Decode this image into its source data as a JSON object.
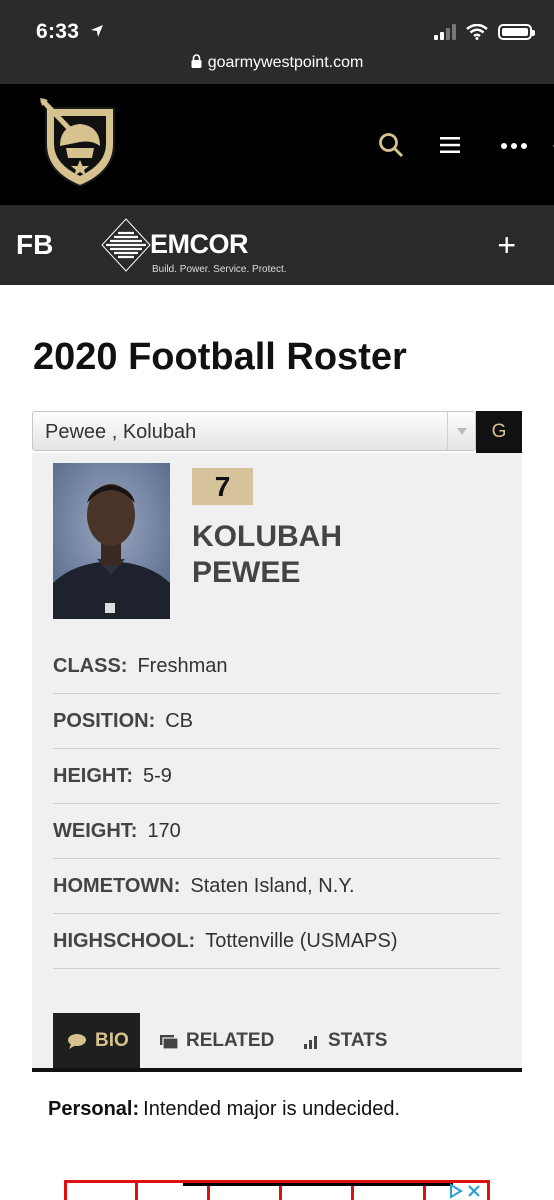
{
  "status_bar": {
    "time": "6:33",
    "url": "goarmywestpoint.com"
  },
  "header": {
    "icons": [
      "search-icon",
      "menu-icon",
      "more-icon",
      "ticket-icon"
    ]
  },
  "sponsor": {
    "sport": "FB",
    "brand": "EMCOR",
    "tagline": "Build. Power. Service. Protect."
  },
  "page": {
    "title": "2020 Football Roster"
  },
  "selector": {
    "selected": "Pewee , Kolubah",
    "go_label": "G"
  },
  "player": {
    "number": "7",
    "first_name": "KOLUBAH",
    "last_name": "PEWEE",
    "info": [
      {
        "label": "CLASS:",
        "value": "Freshman"
      },
      {
        "label": "POSITION:",
        "value": "CB"
      },
      {
        "label": "HEIGHT:",
        "value": "5-9"
      },
      {
        "label": "WEIGHT:",
        "value": "170"
      },
      {
        "label": "HOMETOWN:",
        "value": "Staten Island, N.Y."
      },
      {
        "label": "HIGHSCHOOL:",
        "value": "Tottenville (USMAPS)"
      }
    ]
  },
  "tabs": [
    {
      "label": "BIO",
      "active": true,
      "icon": "speech-bubble-icon"
    },
    {
      "label": "RELATED",
      "active": false,
      "icon": "stack-icon"
    },
    {
      "label": "STATS",
      "active": false,
      "icon": "bar-chart-icon"
    }
  ],
  "bio": {
    "personal_label": "Personal:",
    "personal_text": "Intended major is undecided."
  },
  "colors": {
    "gold": "#d6c28e",
    "black": "#000000",
    "badge": "#d6c29b"
  }
}
